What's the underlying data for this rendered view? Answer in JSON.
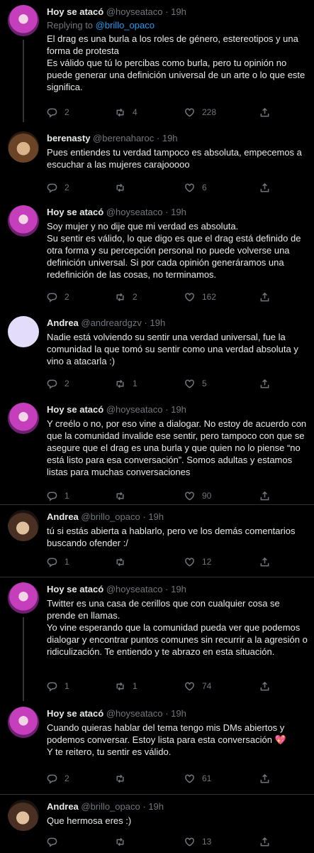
{
  "tweets": [
    {
      "name": "Hoy se atacó",
      "handle": "@hoyseataco",
      "time": "19h",
      "reply_prefix": "Replying to ",
      "reply_user": "@brillo_opaco",
      "lines": [
        "El drag es una burla a los roles de género, estereotipos y una forma de protesta",
        "Es válido que tú lo percibas como burla, pero tu opinión no puede generar una definición universal de un arte o lo que este significa."
      ],
      "replies": "2",
      "retweets": "4",
      "likes": "228"
    },
    {
      "name": "berenasty",
      "handle": "@berenaharoc",
      "time": "19h",
      "lines": [
        "Pues entiendes tu verdad tampoco es absoluta, empecemos a escuchar a las mujeres carajooooo"
      ],
      "replies": "2",
      "retweets": "",
      "likes": "6"
    },
    {
      "name": "Hoy se atacó",
      "handle": "@hoyseataco",
      "time": "19h",
      "lines": [
        "Soy mujer y no dije que mi verdad es absoluta.",
        "Su sentir es válido, lo que digo es que el drag está definido de otra forma y su percepción personal no puede volverse una definición universal. Si por cada opinión generáramos una redefinición de las cosas, no terminamos."
      ],
      "replies": "2",
      "retweets": "2",
      "likes": "162"
    },
    {
      "name": "Andrea",
      "handle": "@andreardgzv",
      "time": "19h",
      "lines": [
        "Nadie está volviendo su sentir una verdad universal, fue la comunidad la que tomó su sentir como una verdad absoluta y vino a atacarla :)"
      ],
      "replies": "2",
      "retweets": "1",
      "likes": "5"
    },
    {
      "name": "Hoy se atacó",
      "handle": "@hoyseataco",
      "time": "19h",
      "lines": [
        "Y creélo o no, por eso vine a dialogar. No estoy de acuerdo con que la comunidad invalide ese sentir, pero tampoco con que se asegure que el drag es una burla y que quien no lo piense “no está listo para esa conversación”. Somos adultas y estamos listas para muchas conversaciones"
      ],
      "replies": "1",
      "retweets": "",
      "likes": "90"
    },
    {
      "name": "Andrea",
      "handle": "@brillo_opaco",
      "time": "19h",
      "lines": [
        "tú si estás abierta a hablarlo, pero ve los demás comentarios buscando ofender :/"
      ],
      "replies": "1",
      "retweets": "",
      "likes": "12"
    },
    {
      "name": "Hoy se atacó",
      "handle": "@hoyseataco",
      "time": "19h",
      "lines": [
        "Twitter es una casa de cerillos que con cualquier cosa se prende en llamas.",
        "Yo vine esperando que la comunidad pueda ver que podemos dialogar y encontrar puntos comunes sin recurrir a la agresión o ridiculización. Te entiendo y te abrazo en esta situación."
      ],
      "replies": "1",
      "retweets": "1",
      "likes": "74"
    },
    {
      "name": "Hoy se atacó",
      "handle": "@hoyseataco",
      "time": "19h",
      "lines": [
        "Cuando quieras hablar del tema tengo mis DMs abiertos y podemos conversar. Estoy lista para esta conversación",
        "Y te reitero, tu sentir es válido."
      ],
      "emoji": "💖",
      "replies": "2",
      "retweets": "",
      "likes": "61"
    },
    {
      "name": "Andrea",
      "handle": "@brillo_opaco",
      "time": "19h",
      "lines": [
        "Que hermosa eres :)"
      ],
      "replies": "",
      "retweets": "",
      "likes": "13"
    }
  ],
  "icons": [
    "reply-icon",
    "retweet-icon",
    "like-icon",
    "share-icon"
  ],
  "colors": {
    "background": "#000000",
    "text": "#e7e9ea",
    "muted": "#71767b",
    "link": "#1d9bf0",
    "divider": "#2f3336"
  }
}
